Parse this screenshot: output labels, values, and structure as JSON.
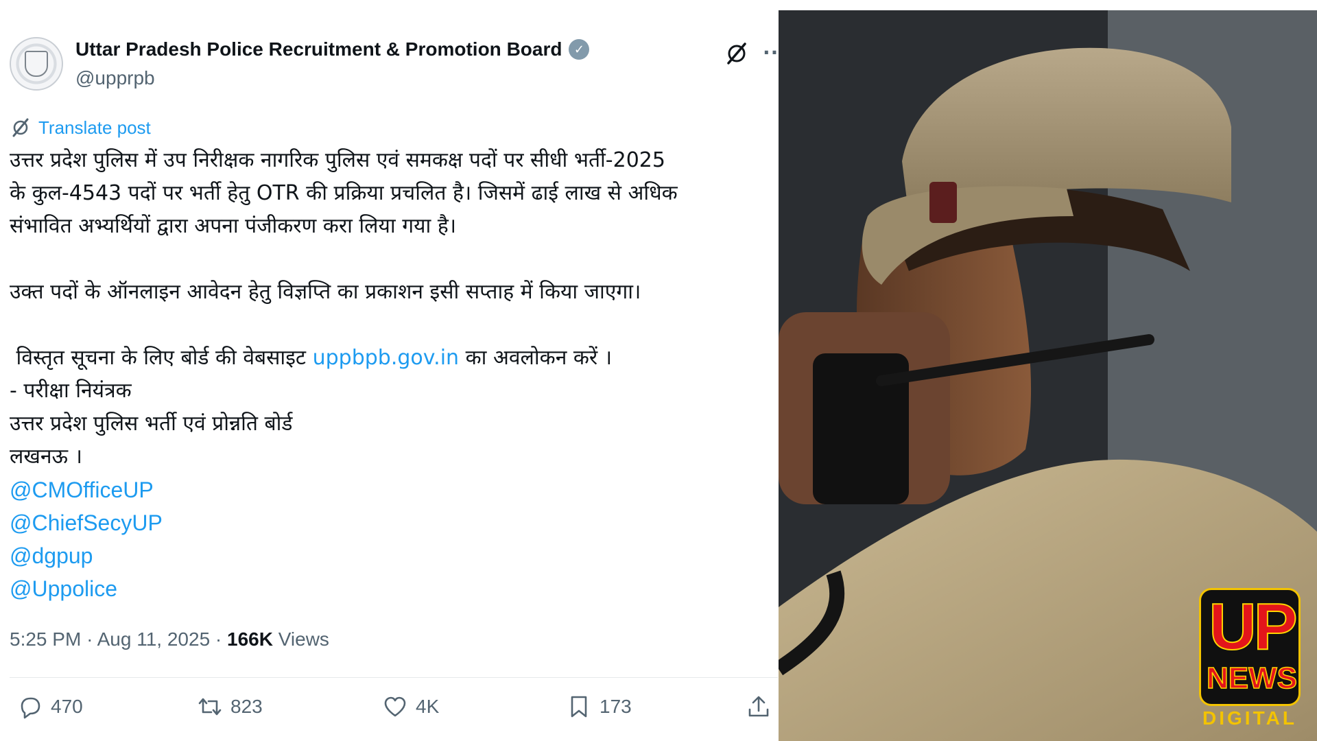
{
  "tweet": {
    "author_name": "Uttar Pradesh Police Recruitment & Promotion Board",
    "handle": "@upprpb",
    "translate_label": "Translate post",
    "body": {
      "line1": "उत्तर प्रदेश पुलिस में उप निरीक्षक नागरिक पुलिस एवं समकक्ष पदों पर सीधी भर्ती-2025",
      "line2": "के कुल-4543 पदों पर भर्ती हेतु OTR की प्रक्रिया प्रचलित है। जिसमें ढाई लाख से अधिक",
      "line3": "संभावित अभ्यर्थियों द्वारा अपना पंजीकरण करा लिया गया है।",
      "line4": "उक्त पदों के ऑनलाइन आवेदन हेतु विज्ञप्ति का प्रकाशन इसी सप्ताह में किया जाएगा।",
      "line5_pre": " विस्तृत सूचना के लिए बोर्ड की वेबसाइट ",
      "line5_link": "uppbpb.gov.in",
      "line5_post": " का अवलोकन करें ।",
      "line6": "- परीक्षा नियंत्रक",
      "line7": "उत्तर प्रदेश पुलिस भर्ती एवं प्रोन्नति बोर्ड",
      "line8": "लखनऊ ।"
    },
    "mentions": [
      "@CMOfficeUP",
      "@ChiefSecyUP",
      "@dgpup",
      "@Uppolice"
    ],
    "time": "5:25 PM",
    "date": "Aug 11, 2025",
    "views_count": "166K",
    "views_label": "Views",
    "separator": "·",
    "actions": {
      "replies": "470",
      "reposts": "823",
      "likes": "4K",
      "bookmarks": "173"
    },
    "icons": [
      "verified-badge-icon",
      "grok-icon",
      "more-icon",
      "translate-icon",
      "reply-icon",
      "repost-icon",
      "like-icon",
      "bookmark-icon",
      "share-icon"
    ]
  },
  "logo": {
    "up": "UP",
    "news": "NEWS",
    "digital": "DIGITAL"
  },
  "colors": {
    "link": "#1d9bf0",
    "secondary_text": "#536471",
    "primary_text": "#0f1419",
    "verified": "#829aab",
    "logo_red": "#e3151b",
    "logo_yellow": "#f3c300"
  }
}
